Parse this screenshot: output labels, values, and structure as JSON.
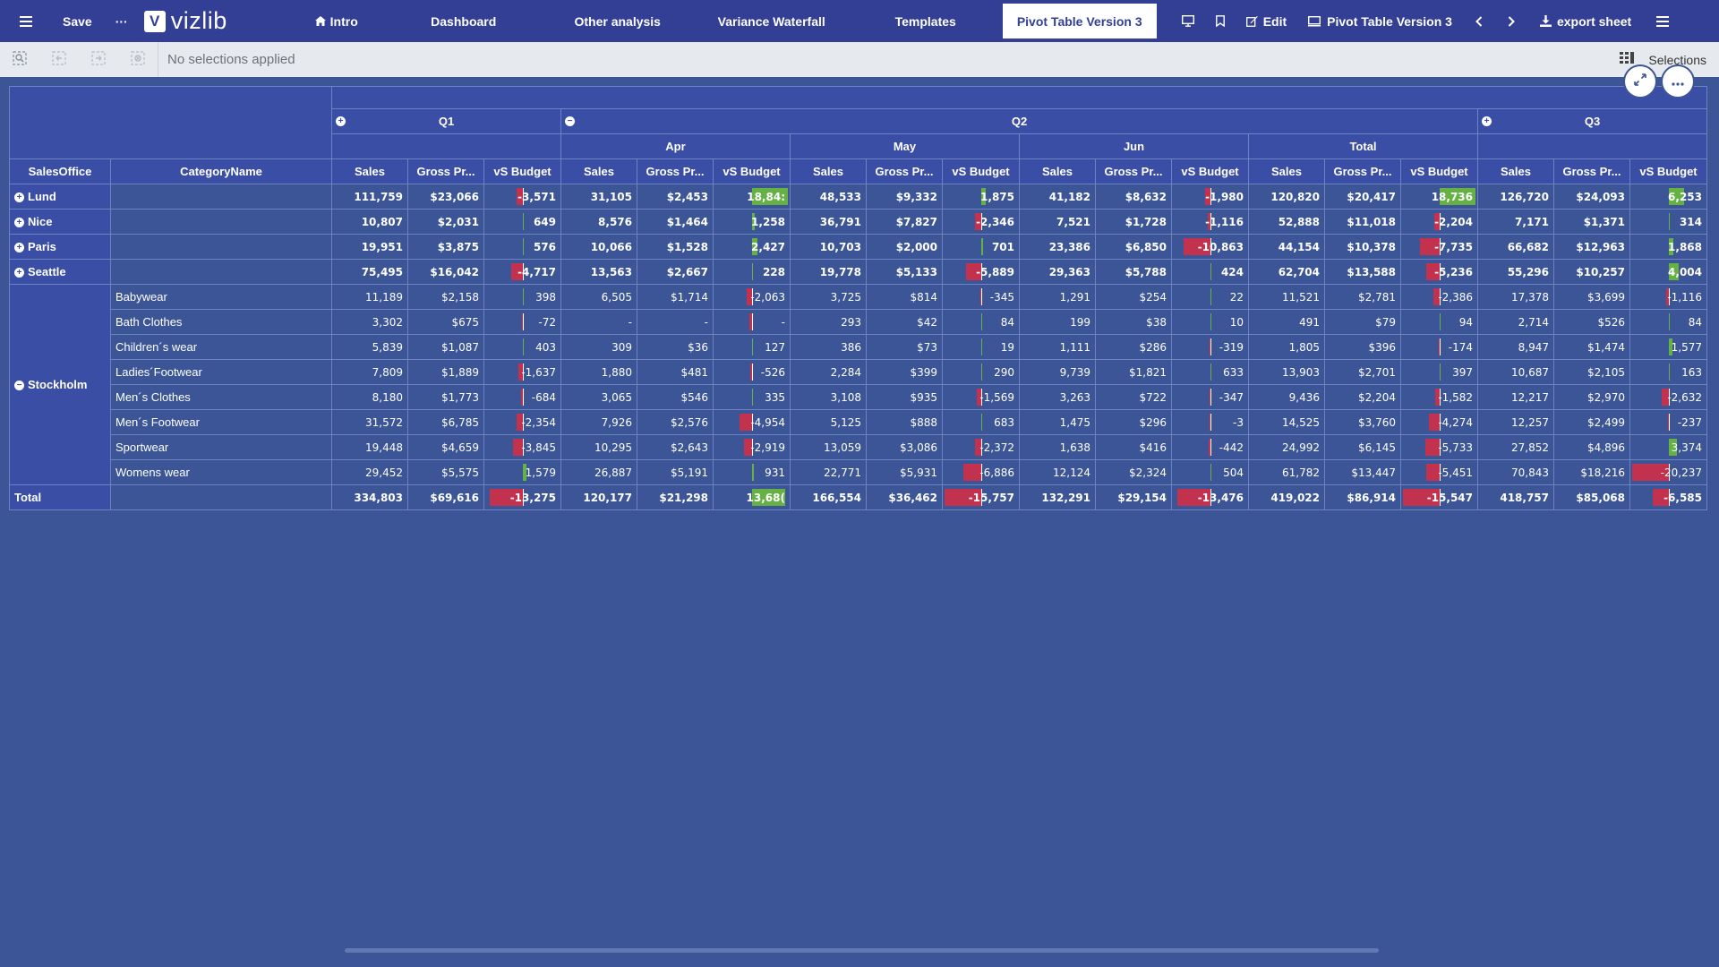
{
  "topbar": {
    "save_label": "Save",
    "more_label": "···",
    "logo_mark": "V",
    "logo_text": "vizlib",
    "tabs": [
      {
        "label": "Intro",
        "icon": "home-icon"
      },
      {
        "label": "Dashboard"
      },
      {
        "label": "Other analysis"
      },
      {
        "label": "Variance Waterfall"
      },
      {
        "label": "Templates"
      },
      {
        "label": "Pivot Table Version 3",
        "active": true
      }
    ],
    "edit_label": "Edit",
    "sheet_name": "Pivot Table Version 3",
    "export_label": "export sheet"
  },
  "selection_bar": {
    "text": "No selections applied",
    "selections_label": "Selections"
  },
  "pivot": {
    "row_headers": {
      "office": "SalesOffice",
      "category": "CategoryName"
    },
    "quarters": {
      "q1": "Q1",
      "q2": "Q2",
      "q3": "Q3"
    },
    "months": {
      "apr": "Apr",
      "may": "May",
      "jun": "Jun",
      "total": "Total"
    },
    "measures": {
      "sales": "Sales",
      "gross": "Gross Pr...",
      "budget": "vS Budget"
    },
    "total_label": "Total",
    "rows": [
      {
        "office": "Lund",
        "toggle": "+",
        "cells": [
          "111,759",
          "$23,066",
          "-3,571",
          "31,105",
          "$2,453",
          "18,84:",
          "48,533",
          "$9,332",
          "1,875",
          "41,182",
          "$8,632",
          "-1,980",
          "120,820",
          "$20,417",
          "18,736",
          "126,720",
          "$24,093",
          "6,253"
        ],
        "bars": [
          -0.15,
          null,
          null,
          0.95,
          null,
          null,
          0.12,
          null,
          null,
          -0.12,
          null,
          null,
          0.95,
          null,
          null,
          0.4
        ]
      },
      {
        "office": "Nice",
        "toggle": "+",
        "cells": [
          "10,807",
          "$2,031",
          "649",
          "8,576",
          "$1,464",
          "1,258",
          "36,791",
          "$7,827",
          "-2,346",
          "7,521",
          "$1,728",
          "-1,116",
          "52,888",
          "$11,018",
          "-2,204",
          "7,171",
          "$1,371",
          "314"
        ],
        "bars": [
          0.04,
          null,
          null,
          0.08,
          null,
          null,
          -0.15,
          null,
          null,
          -0.07,
          null,
          null,
          -0.14,
          null,
          null,
          0.02
        ]
      },
      {
        "office": "Paris",
        "toggle": "+",
        "cells": [
          "19,951",
          "$3,875",
          "576",
          "10,066",
          "$1,528",
          "2,427",
          "10,703",
          "$2,000",
          "701",
          "23,386",
          "$6,850",
          "-10,863",
          "44,154",
          "$10,378",
          "-7,735",
          "66,682",
          "$12,963",
          "1,868"
        ],
        "bars": [
          0.04,
          null,
          null,
          0.16,
          null,
          null,
          0.05,
          null,
          null,
          -0.7,
          null,
          null,
          -0.5,
          null,
          null,
          0.12
        ]
      },
      {
        "office": "Seattle",
        "toggle": "+",
        "cells": [
          "75,495",
          "$16,042",
          "-4,717",
          "13,563",
          "$2,667",
          "228",
          "19,778",
          "$5,133",
          "-5,889",
          "29,363",
          "$5,788",
          "424",
          "62,704",
          "$13,588",
          "-5,236",
          "55,296",
          "$10,257",
          "4,004"
        ],
        "bars": [
          -0.3,
          null,
          null,
          0.02,
          null,
          null,
          -0.38,
          null,
          null,
          0.03,
          null,
          null,
          -0.34,
          null,
          null,
          0.26
        ]
      }
    ],
    "stockholm": {
      "office": "Stockholm",
      "toggle": "−",
      "rows": [
        {
          "category": "Babywear",
          "cells": [
            "11,189",
            "$2,158",
            "398",
            "6,505",
            "$1,714",
            "-2,063",
            "3,725",
            "$814",
            "-345",
            "1,291",
            "$254",
            "22",
            "11,521",
            "$2,781",
            "-2,386",
            "17,378",
            "$3,699",
            "-1,116"
          ],
          "bars": [
            0.03,
            null,
            null,
            -0.14,
            null,
            null,
            -0.02,
            null,
            null,
            0.01,
            null,
            null,
            -0.15,
            null,
            null,
            -0.07
          ]
        },
        {
          "category": "Bath Clothes",
          "cells": [
            "3,302",
            "$675",
            "-72",
            "-",
            "-",
            "-",
            "293",
            "$42",
            "84",
            "199",
            "$38",
            "10",
            "491",
            "$79",
            "94",
            "2,714",
            "$526",
            "84"
          ],
          "bars": [
            -0.01,
            null,
            null,
            -0.05,
            null,
            null,
            0.01,
            null,
            null,
            0.01,
            null,
            null,
            0.01,
            null,
            null,
            0.01
          ]
        },
        {
          "category": "Children´s wear",
          "cells": [
            "5,839",
            "$1,087",
            "403",
            "309",
            "$36",
            "127",
            "386",
            "$73",
            "19",
            "1,111",
            "$286",
            "-319",
            "1,805",
            "$396",
            "-174",
            "8,947",
            "$1,474",
            "1,577"
          ],
          "bars": [
            0.03,
            null,
            null,
            0.01,
            null,
            null,
            0.01,
            null,
            null,
            -0.02,
            null,
            null,
            -0.01,
            null,
            null,
            0.1
          ]
        },
        {
          "category": "Ladies´Footwear",
          "cells": [
            "7,809",
            "$1,889",
            "-1,637",
            "1,880",
            "$481",
            "-526",
            "2,284",
            "$399",
            "290",
            "9,739",
            "$1,821",
            "633",
            "13,903",
            "$2,701",
            "397",
            "10,687",
            "$2,105",
            "163"
          ],
          "bars": [
            -0.1,
            null,
            null,
            -0.03,
            null,
            null,
            0.02,
            null,
            null,
            0.04,
            null,
            null,
            0.03,
            null,
            null,
            0.01
          ]
        },
        {
          "category": "Men´s Clothes",
          "cells": [
            "8,180",
            "$1,773",
            "-684",
            "3,065",
            "$546",
            "335",
            "3,108",
            "$935",
            "-1,569",
            "3,263",
            "$722",
            "-347",
            "9,436",
            "$2,204",
            "-1,582",
            "12,217",
            "$2,970",
            "-2,632"
          ],
          "bars": [
            -0.04,
            null,
            null,
            0.02,
            null,
            null,
            -0.1,
            null,
            null,
            -0.02,
            null,
            null,
            -0.1,
            null,
            null,
            -0.17
          ]
        },
        {
          "category": "Men´s Footwear",
          "cells": [
            "31,572",
            "$6,785",
            "-2,354",
            "7,926",
            "$2,576",
            "-4,954",
            "5,125",
            "$888",
            "683",
            "1,475",
            "$296",
            "-3",
            "14,525",
            "$3,760",
            "-4,274",
            "12,257",
            "$2,499",
            "-237"
          ],
          "bars": [
            -0.15,
            null,
            null,
            -0.32,
            null,
            null,
            0.04,
            null,
            null,
            -0.01,
            null,
            null,
            -0.28,
            null,
            null,
            -0.02
          ]
        },
        {
          "category": "Sportwear",
          "cells": [
            "19,448",
            "$4,659",
            "-3,845",
            "10,295",
            "$2,643",
            "-2,919",
            "13,059",
            "$3,086",
            "-2,372",
            "1,638",
            "$416",
            "-442",
            "24,992",
            "$6,145",
            "-5,733",
            "27,852",
            "$4,896",
            "3,374"
          ],
          "bars": [
            -0.25,
            null,
            null,
            -0.19,
            null,
            null,
            -0.15,
            null,
            null,
            -0.03,
            null,
            null,
            -0.37,
            null,
            null,
            0.22
          ]
        },
        {
          "category": "Womens wear",
          "cells": [
            "29,452",
            "$5,575",
            "1,579",
            "26,887",
            "$5,191",
            "931",
            "22,771",
            "$5,931",
            "-6,886",
            "12,124",
            "$2,324",
            "504",
            "61,782",
            "$13,447",
            "-5,451",
            "70,843",
            "$18,216",
            "-20,237"
          ],
          "bars": [
            0.1,
            null,
            null,
            0.06,
            null,
            null,
            -0.45,
            null,
            null,
            0.03,
            null,
            null,
            -0.35,
            null,
            null,
            -0.95
          ]
        }
      ]
    },
    "total_row": {
      "cells": [
        "334,803",
        "$69,616",
        "-13,275",
        "120,177",
        "$21,298",
        "13,68(",
        "166,554",
        "$36,462",
        "-15,757",
        "132,291",
        "$29,154",
        "-13,476",
        "419,022",
        "$86,914",
        "-15,547",
        "418,757",
        "$85,068",
        "-6,585"
      ],
      "bars": [
        -0.85,
        null,
        null,
        0.88,
        null,
        null,
        -0.95,
        null,
        null,
        -0.87,
        null,
        null,
        -0.95,
        null,
        null,
        -0.42
      ]
    }
  },
  "colors": {
    "topbar": "#323f94",
    "background": "#3c5596",
    "header": "#3b4ea6",
    "positive": "#65b144",
    "negative": "#c2324f"
  }
}
